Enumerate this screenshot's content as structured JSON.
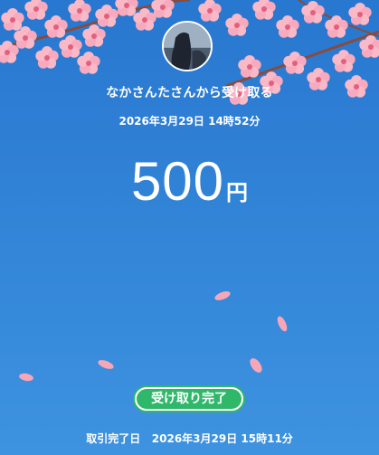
{
  "sender": {
    "text": "なかさんたさんから受け取る"
  },
  "sent_at": "2026年3月29日 14時52分",
  "amount": {
    "value": "500",
    "unit": "円"
  },
  "status": {
    "label": "受け取り完了"
  },
  "completion": {
    "label": "取引完了日",
    "date": "2026年3月29日 15時11分"
  },
  "colors": {
    "background": "#2f80d6",
    "badge": "#2fb86a",
    "petal": "#f7a6b8"
  }
}
